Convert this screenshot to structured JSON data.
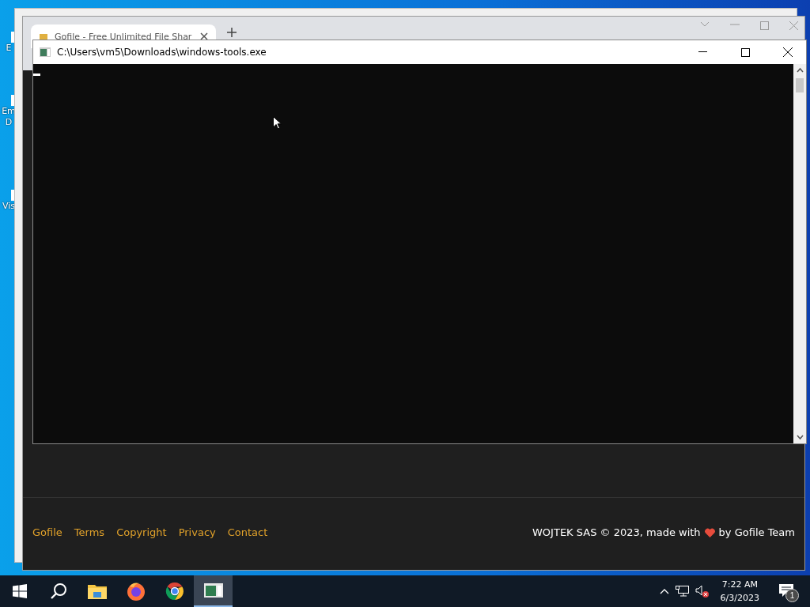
{
  "desktop": {
    "icons": [
      {
        "lines": [
          "E"
        ]
      },
      {
        "lines": [
          "Em",
          "D"
        ]
      },
      {
        "lines": [
          "Vis"
        ]
      }
    ]
  },
  "browser": {
    "tab": {
      "title": "Gofile - Free Unlimited File Shar"
    },
    "footer": {
      "links": [
        "Gofile",
        "Terms",
        "Copyright",
        "Privacy",
        "Contact"
      ],
      "credit_before": "WOJTEK SAS © 2023, made with",
      "credit_after": "by Gofile Team"
    }
  },
  "console": {
    "title": "C:\\Users\\vm5\\Downloads\\windows-tools.exe"
  },
  "taskbar": {
    "apps": [
      {
        "kind": "start",
        "selected": false
      },
      {
        "kind": "search",
        "selected": false
      },
      {
        "kind": "explorer",
        "selected": false
      },
      {
        "kind": "firefox",
        "selected": false
      },
      {
        "kind": "chrome",
        "selected": false
      },
      {
        "kind": "console",
        "selected": true
      }
    ],
    "clock": {
      "time": "7:22 AM",
      "date": "6/3/2023"
    },
    "notifications": {
      "count": "1"
    }
  }
}
